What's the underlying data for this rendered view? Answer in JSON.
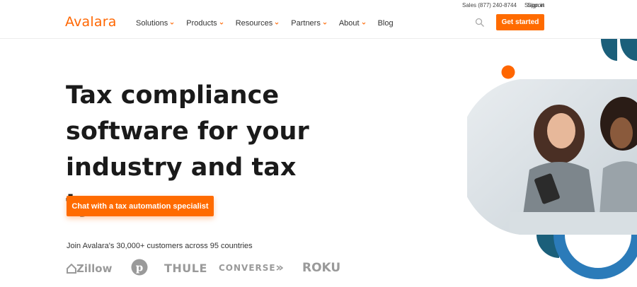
{
  "brand": {
    "logo_text": "Avalara",
    "accent_color": "#ff6b00",
    "teal_color": "#1b5f7a",
    "blue_color": "#2b7bb9"
  },
  "utility_nav": {
    "sales": "Sales (877) 240-8744",
    "support": "Support",
    "sign_in": "Sign in"
  },
  "nav": {
    "items": [
      {
        "label": "Solutions",
        "has_dropdown": true
      },
      {
        "label": "Products",
        "has_dropdown": true
      },
      {
        "label": "Resources",
        "has_dropdown": true
      },
      {
        "label": "Partners",
        "has_dropdown": true
      },
      {
        "label": "About",
        "has_dropdown": true
      },
      {
        "label": "Blog",
        "has_dropdown": false
      }
    ],
    "search_icon": "search-icon",
    "cta": "Get started"
  },
  "hero": {
    "headline_line1": "Tax compliance",
    "headline_line2": "software for your",
    "headline_line3": "industry and tax type",
    "cta": "Chat with a tax automation specialist",
    "customers_text": "Join Avalara's 30,000+ customers across 95 countries",
    "image_description_icon": "photo-two-women-with-phone"
  },
  "customer_logos": [
    "Zillow",
    "Pinterest",
    "THULE",
    "CONVERSE",
    "ROKU"
  ]
}
